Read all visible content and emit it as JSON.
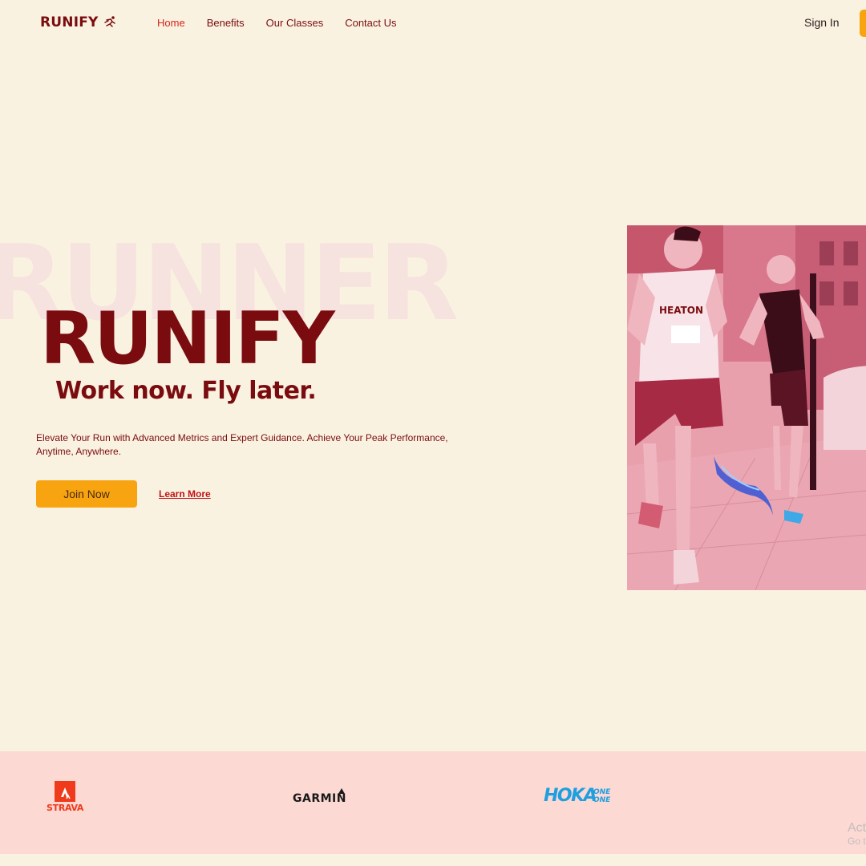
{
  "header": {
    "logo": "RUNIFY",
    "nav": [
      {
        "label": "Home",
        "active": true
      },
      {
        "label": "Benefits"
      },
      {
        "label": "Our Classes"
      },
      {
        "label": "Contact Us"
      }
    ],
    "signin_label": "Sign In"
  },
  "hero": {
    "background_word": "RUNNER",
    "title": "RUNIFY",
    "tagline": "Work now. Fly later.",
    "description": "Elevate Your Run with Advanced Metrics and Expert Guidance. Achieve Your Peak Performance, Anytime, Anywhere.",
    "primary_button": "Join Now",
    "secondary_link": "Learn More"
  },
  "brands": {
    "strava": "STRAVA",
    "garmin": "GARMIN",
    "hoka": "HOKA",
    "hoka_sub": [
      "ONE",
      "ONE"
    ]
  },
  "os_watermark": {
    "line1": "Act",
    "line2": "Go t"
  },
  "colors": {
    "background": "#faf2e0",
    "primary": "#7a0c10",
    "accent": "#f7a410",
    "link": "#c0141a",
    "brand_strip": "#fdd9d4"
  },
  "icons": [
    "runner-icon"
  ]
}
